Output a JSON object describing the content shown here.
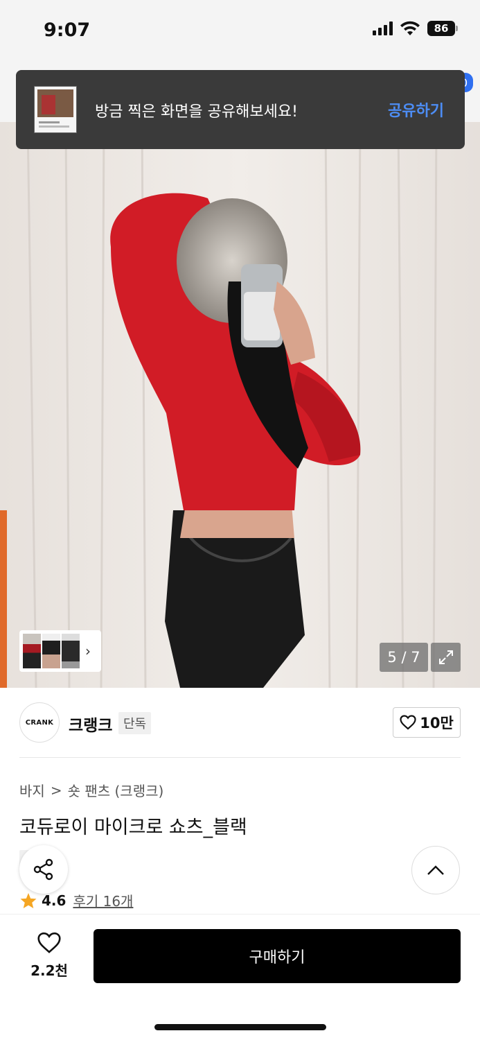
{
  "status_bar": {
    "time": "9:07",
    "battery": "86"
  },
  "toast": {
    "message": "방금 찍은 화면을 공유해보세요!",
    "action": "공유하기"
  },
  "gallery": {
    "counter": "5 / 7"
  },
  "brand": {
    "logo_text": "CRANK",
    "name": "크랭크",
    "badge": "단독",
    "likes": "10만"
  },
  "breadcrumb": {
    "category": "바지",
    "separator": ">",
    "subcategory": "숏 팬츠 (크랭크)"
  },
  "product": {
    "title": "코듀로이 마이크로 쇼츠_블랙",
    "badge": "단독"
  },
  "rating": {
    "value": "4.6",
    "reviews": "후기 16개"
  },
  "bottom_bar": {
    "wish_count": "2.2천",
    "buy_label": "구매하기"
  },
  "colors": {
    "accent_blue": "#4d8df5",
    "toast_bg": "#3a3a3a",
    "star": "#f5a623",
    "button_black": "#000000"
  }
}
